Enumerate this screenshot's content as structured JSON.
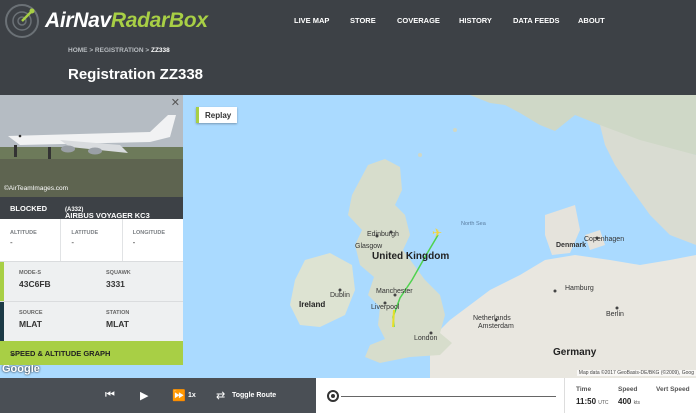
{
  "header": {
    "brand_main": "AirNav",
    "brand_accent": "RadarBox",
    "nav": [
      "LIVE MAP",
      "STORE",
      "COVERAGE",
      "HISTORY",
      "DATA FEEDS",
      "ABOUT"
    ],
    "breadcrumb": {
      "home": "HOME",
      "sep": ">",
      "section": "REGISTRATION",
      "current": "ZZ338"
    },
    "title": "Registration ZZ338"
  },
  "map": {
    "replay_label": "Replay",
    "labels": {
      "uk": "United Kingdom",
      "ireland": "Ireland",
      "denmark": "Denmark",
      "germany": "Germany",
      "glasgow": "Glasgow",
      "edinburgh": "Edinburgh",
      "dublin": "Dublin",
      "manchester": "Manchester",
      "liverpool": "Liverpool",
      "london": "London",
      "hamburg": "Hamburg",
      "berlin": "Berlin",
      "copenhagen": "Copenhagen",
      "amsterdam": "Amsterdam",
      "netherlands": "Netherlands",
      "north_sea": "North Sea"
    },
    "google": "Google",
    "attribution": "Map data ©2017 GeoBasis-DE/BKG (©2009), Goog"
  },
  "panel": {
    "image_credit": "©AirTeamImages.com",
    "status": "BLOCKED",
    "aircraft_type": "AIRBUS VOYAGER KC3",
    "aircraft_type_code": "(A332)",
    "altitude_label": "ALTITUDE",
    "altitude_value": "-",
    "latitude_label": "LATITUDE",
    "latitude_value": "-",
    "longitude_label": "LONGITUDE",
    "longitude_value": "-",
    "mode_s_label": "MODE-S",
    "mode_s_value": "43C6FB",
    "squawk_label": "SQUAWK",
    "squawk_value": "3331",
    "source_label": "SOURCE",
    "source_value": "MLAT",
    "station_label": "STATION",
    "station_value": "MLAT",
    "graph_label": "SPEED & ALTITUDE GRAPH"
  },
  "playback": {
    "speed_multiplier": "1x",
    "toggle_label": "Toggle Route",
    "time_label": "Time",
    "time_value": "11:50",
    "time_unit": "UTC",
    "speed_label": "Speed",
    "speed_value": "400",
    "speed_unit": "kts",
    "vspeed_label": "Vert Speed",
    "vspeed_value": ""
  },
  "colors": {
    "accent": "#a8cf45",
    "header_bg": "#3d4146",
    "route": "#4fd24f",
    "route_start": "#e6e02a"
  }
}
